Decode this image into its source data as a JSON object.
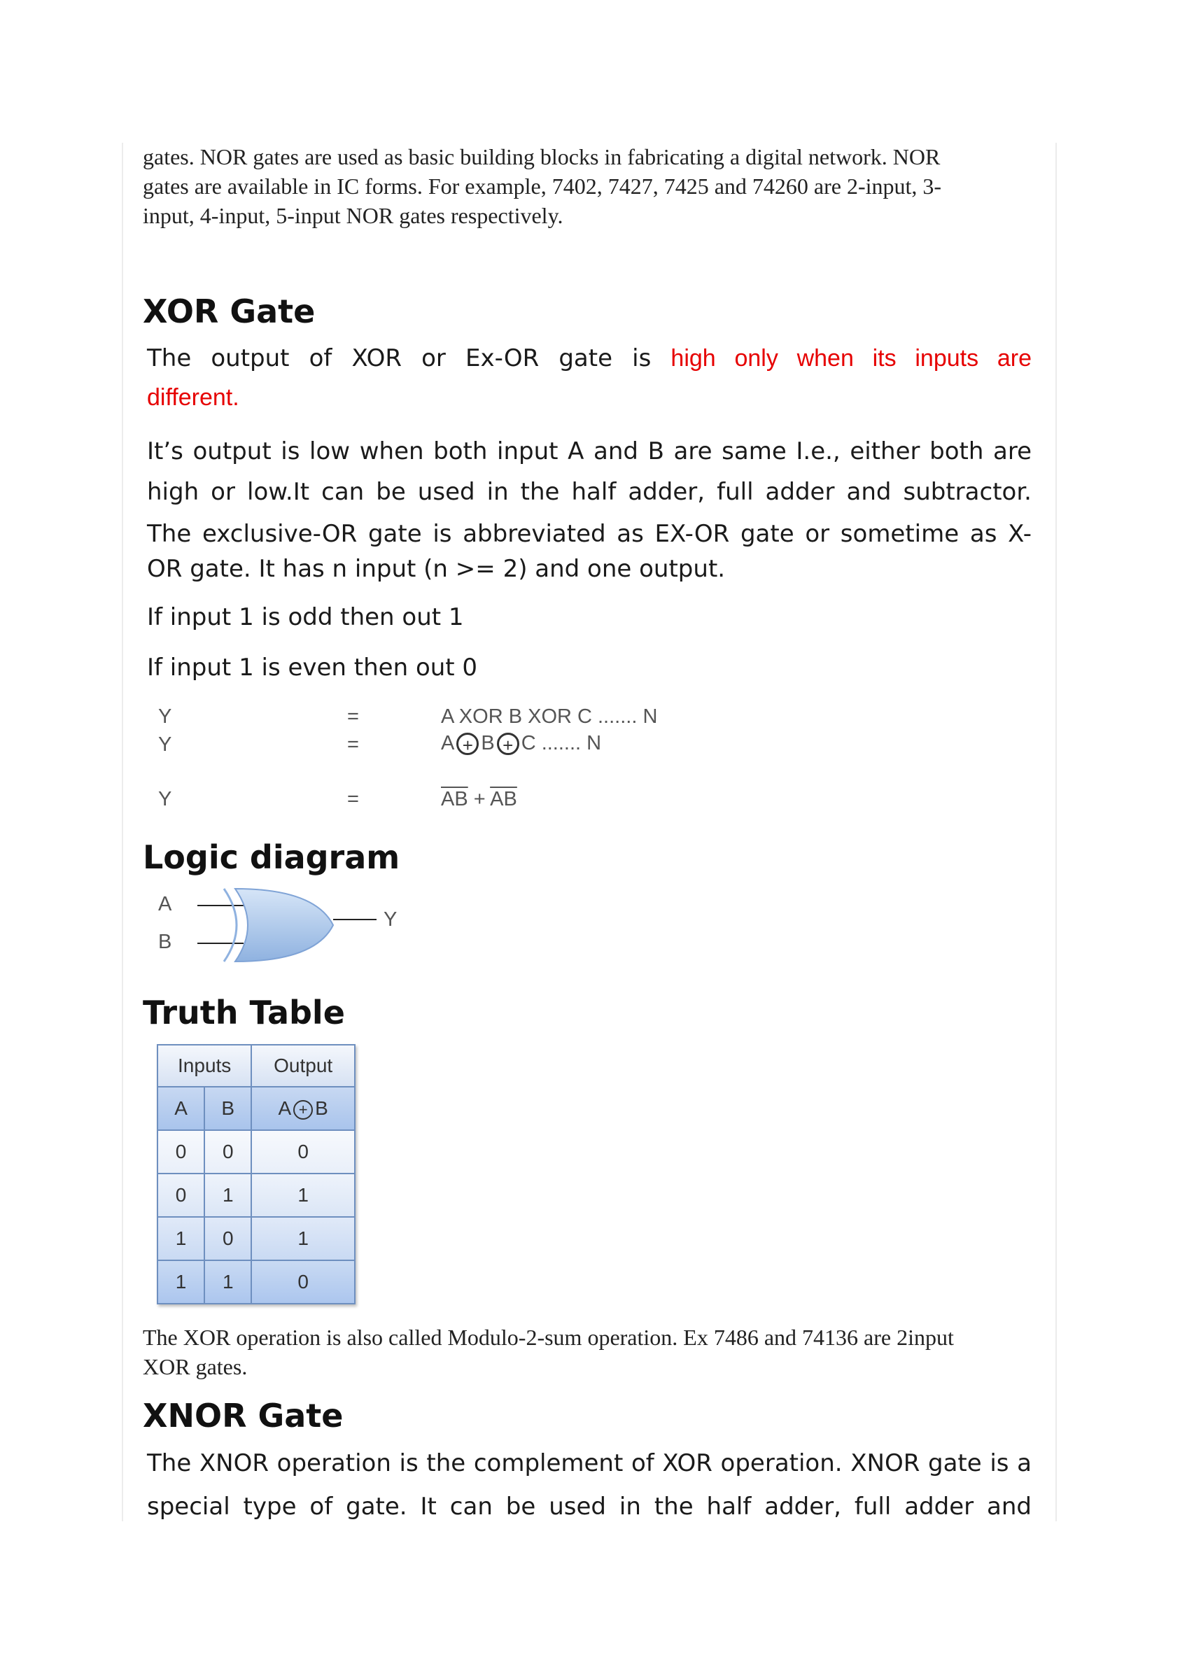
{
  "intro": {
    "lines": [
      "gates. NOR gates are used as basic building blocks in fabricating a digital network. NOR",
      "gates are available in IC forms. For example, 7402, 7427, 7425 and 74260 are 2-input, 3-",
      "input, 4-input, 5-input NOR gates respectively."
    ]
  },
  "xor": {
    "heading": "XOR Gate",
    "def_start": "The output of XOR or Ex-OR gate is",
    "def_red": "high only when its inputs are",
    "def_red_end": "different.",
    "para1_line1": "It’s output is low when both input A and B are same I.e., either both are",
    "para1_line2": "high or low.It can be used in the half adder, full adder and subtractor.",
    "para2_line1": "The exclusive-OR gate is abbreviated as EX-OR gate or sometime as X-",
    "para2_line2": "OR gate. It has n input (n >= 2) and one output.",
    "rule1": "If input 1 is odd then out 1",
    "rule2": "If input 1 is even then out 0",
    "equations": {
      "y": "Y",
      "eq": "=",
      "e1": "A XOR B XOR C ....... N",
      "e2_a": "A",
      "e2_b": "B",
      "e2_c": "C ....... N",
      "xor_symbol": "+",
      "e3_a": "AB",
      "e3_plus": " + ",
      "e3_b": "AB"
    }
  },
  "logic": {
    "heading": "Logic diagram",
    "input_a": "A",
    "input_b": "B",
    "output_y": "Y",
    "gate_color": "#a9c6ea"
  },
  "truth": {
    "heading": "Truth Table",
    "inputs_header": "Inputs",
    "output_header": "Output",
    "col_a": "A",
    "col_b": "B",
    "col_out_a": "A",
    "col_out_b": "B",
    "rows": [
      [
        "0",
        "0",
        "0"
      ],
      [
        "0",
        "1",
        "1"
      ],
      [
        "1",
        "0",
        "1"
      ],
      [
        "1",
        "1",
        "0"
      ]
    ]
  },
  "modulo": {
    "line1": "The XOR operation is also called Modulo-2-sum operation. Ex 7486 and 74136 are 2input",
    "line2": "XOR gates."
  },
  "xnor": {
    "heading": "XNOR Gate",
    "line1": "The XNOR operation is the complement of XOR operation. XNOR gate is a",
    "line2": "special type of gate. It can be used in the half adder, full adder and"
  }
}
